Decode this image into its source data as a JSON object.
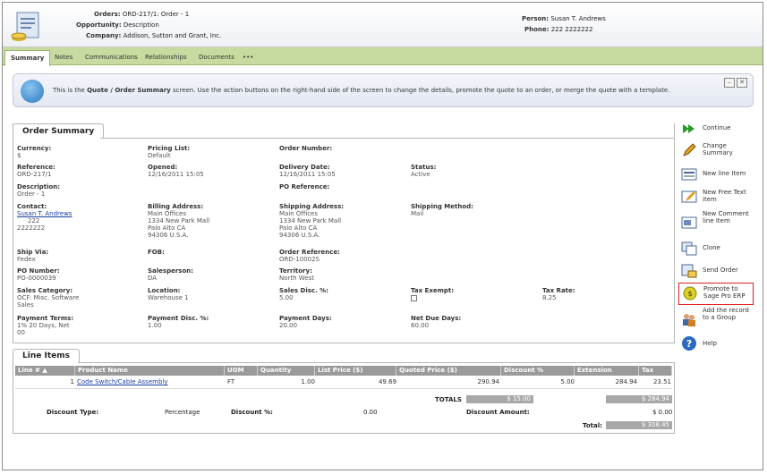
{
  "header": {
    "orders_label": "Orders:",
    "orders_value": "ORD-217/1: Order - 1",
    "opportunity_label": "Opportunity:",
    "opportunity_value": "Description",
    "company_label": "Company:",
    "company_value": "Addison, Sutton and Grant, Inc.",
    "person_label": "Person:",
    "person_value": "Susan T. Andrews",
    "phone_label": "Phone:",
    "phone_value": "222 2222222"
  },
  "tabs": [
    "Summary",
    "Notes",
    "Communications",
    "Relationships",
    "Documents",
    "•••"
  ],
  "info": {
    "text_pre": "This is the ",
    "text_bold": "Quote / Order Summary",
    "text_post": " screen. Use the action buttons on the right-hand side of the screen to change the details, promote the quote to an order, or merge the quote with a template."
  },
  "summary": {
    "tab_label": "Order Summary",
    "currency_label": "Currency:",
    "currency": "$",
    "pricing_list_label": "Pricing List:",
    "pricing_list": "Default",
    "order_number_label": "Order Number:",
    "reference_label": "Reference:",
    "reference": "ORD-217/1",
    "opened_label": "Opened:",
    "opened": "12/16/2011 15:05",
    "delivery_date_label": "Delivery Date:",
    "delivery_date": "12/16/2011 15:05",
    "status_label": "Status:",
    "status": "Active",
    "description_label": "Description:",
    "description": "Order - 1",
    "po_reference_label": "PO Reference:",
    "contact_label": "Contact:",
    "contact": "Susan T. Andrews",
    "contact_ext": "222",
    "contact_phone": "2222222",
    "billing_label": "Billing Address:",
    "billing_1": "Main Offices",
    "billing_2": "1334 New Park Mall",
    "billing_3": "Palo Alto CA",
    "billing_4": "94306 U.S.A.",
    "shipping_label": "Shipping Address:",
    "shipping_1": "Main Offices",
    "shipping_2": "1334 New Park Mall",
    "shipping_3": "Palo Alto CA",
    "shipping_4": "94306 U.S.A.",
    "shipping_method_label": "Shipping Method:",
    "shipping_method": "Mail",
    "ship_via_label": "Ship Via:",
    "ship_via": "Fedex",
    "fob_label": "FOB:",
    "order_reference_label": "Order Reference:",
    "order_reference": "ORD-10002S",
    "po_number_label": "PO Number:",
    "po_number": "PO-0000039",
    "salesperson_label": "Salesperson:",
    "salesperson": "DA",
    "territory_label": "Territory:",
    "territory": "North West",
    "sales_category_label": "Sales Category:",
    "sales_category_1": "OCF: Misc. Software",
    "sales_category_2": "Sales",
    "location_label": "Location:",
    "location": "Warehouse 1",
    "sales_disc_label": "Sales Disc. %:",
    "sales_disc": "5.00",
    "tax_exempt_label": "Tax Exempt:",
    "tax_rate_label": "Tax Rate:",
    "tax_rate": "8.25",
    "payment_terms_label": "Payment Terms:",
    "payment_terms_1": "1% 20 Days, Net",
    "payment_terms_2": "00",
    "payment_disc_label": "Payment Disc. %:",
    "payment_disc": "1.00",
    "payment_days_label": "Payment Days:",
    "payment_days": "20.00",
    "net_due_label": "Net Due Days:",
    "net_due": "60.00"
  },
  "sidebar": [
    {
      "label": "Continue",
      "icon": "continue-icon"
    },
    {
      "label": "Change Summary",
      "icon": "pencil-icon"
    },
    {
      "label": "New line Item",
      "icon": "new-line-icon"
    },
    {
      "label": "New Free Text item",
      "icon": "free-text-icon"
    },
    {
      "label": "New Comment line Item",
      "icon": "comment-line-icon"
    },
    {
      "label": "Clone",
      "icon": "clone-icon"
    },
    {
      "label": "Send Order",
      "icon": "send-order-icon"
    },
    {
      "label": "Promote to Sage Pro ERP",
      "icon": "promote-icon"
    },
    {
      "label": "Add the record to a Group",
      "icon": "group-icon"
    },
    {
      "label": "Help",
      "icon": "help-icon"
    }
  ],
  "line_items": {
    "tab_label": "Line Items",
    "columns": [
      "Line # ▲",
      "Product Name",
      "UOM",
      "Quantity",
      "List Price ($)",
      "Quoted Price ($)",
      "Discount %",
      "Extension",
      "Tax"
    ],
    "row": {
      "line": "1",
      "product": "Code Switch/Cable Assembly",
      "uom": "FT",
      "quantity": "1.00",
      "list_price": "49.69",
      "quoted_price": "290.94",
      "discount": "5.00",
      "extension": "284.94",
      "tax": "23.51"
    },
    "totals_label": "TOTALS",
    "totals_quoted": "$ 15.00",
    "totals_extension": "$ 284.94",
    "discount_type_label": "Discount Type:",
    "discount_type": "Percentage",
    "discount_pct_label": "Discount %:",
    "discount_pct": "0.00",
    "discount_amount_label": "Discount Amount:",
    "discount_amount": "$ 0.00",
    "total_label": "Total:",
    "total": "$ 308.45"
  }
}
